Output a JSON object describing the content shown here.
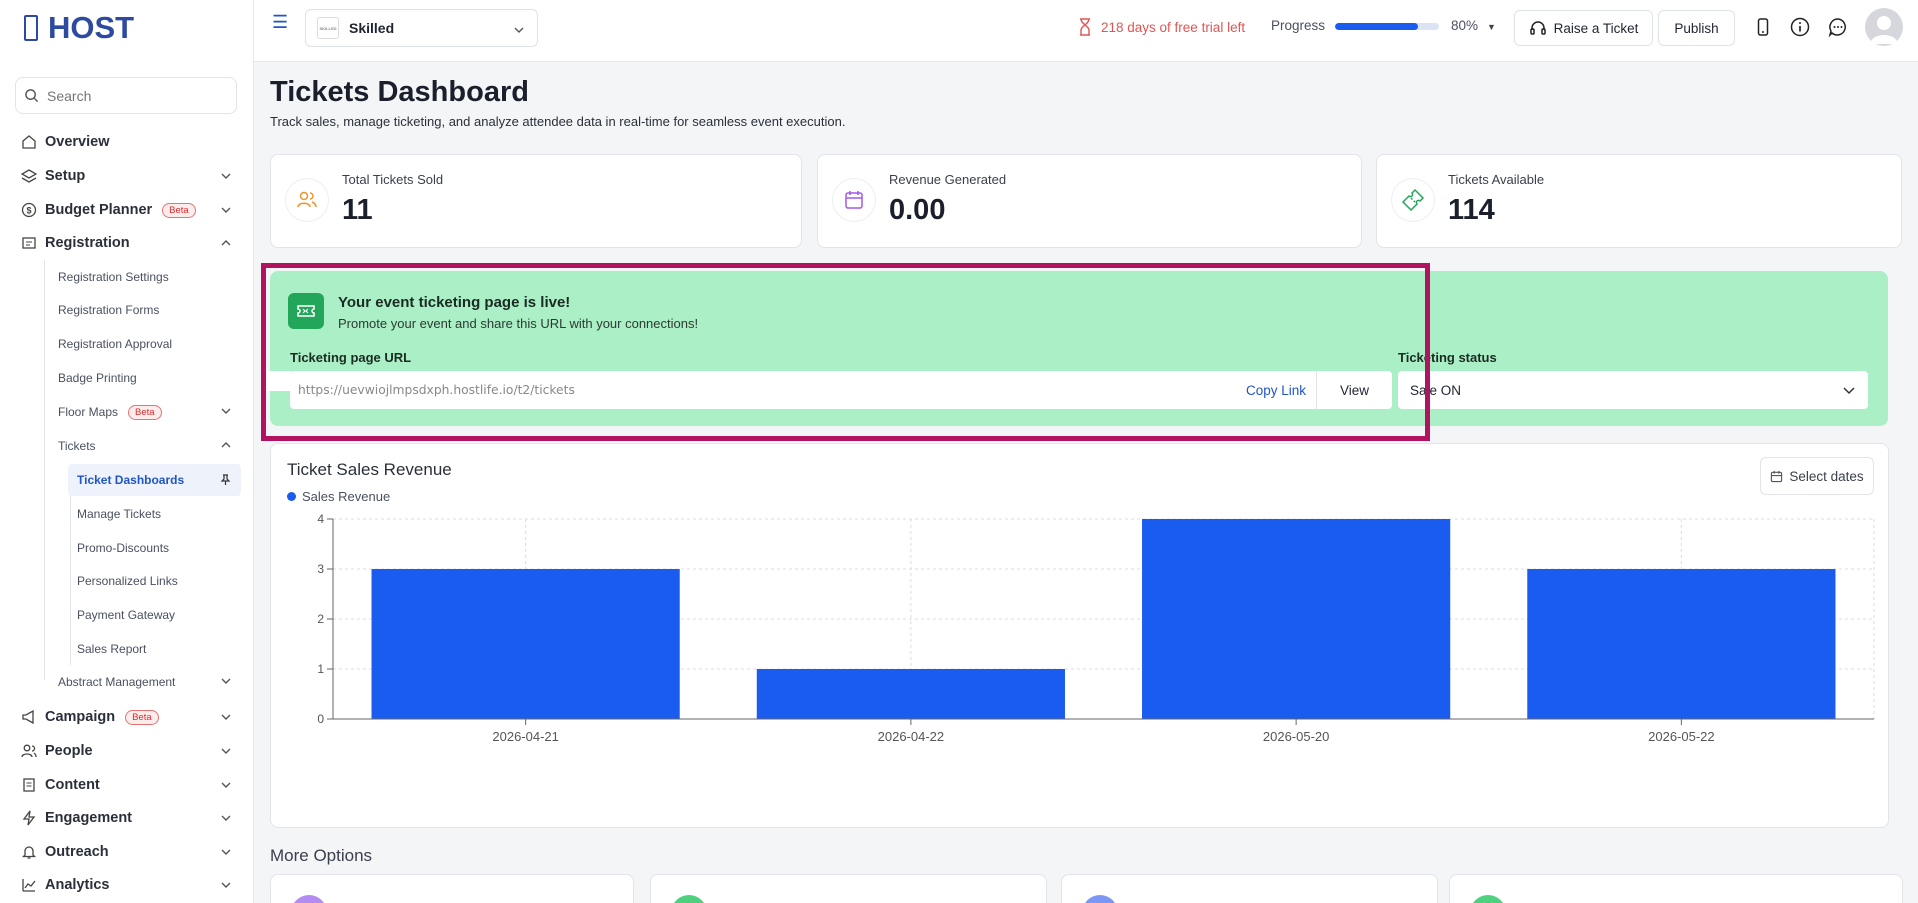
{
  "sidebar": {
    "logo": "HOST",
    "search_placeholder": "Search",
    "items": {
      "overview": "Overview",
      "setup": "Setup",
      "budget_planner": "Budget Planner",
      "registration": "Registration",
      "registration_settings": "Registration Settings",
      "registration_forms": "Registration Forms",
      "registration_approval": "Registration Approval",
      "badge_printing": "Badge Printing",
      "floor_maps": "Floor Maps",
      "tickets": "Tickets",
      "ticket_dashboards": "Ticket Dashboards",
      "manage_tickets": "Manage Tickets",
      "promo_discounts": "Promo-Discounts",
      "personalized_links": "Personalized Links",
      "payment_gateway": "Payment Gateway",
      "sales_report": "Sales Report",
      "abstract_management": "Abstract Management",
      "campaign": "Campaign",
      "people": "People",
      "content": "Content",
      "engagement": "Engagement",
      "outreach": "Outreach",
      "analytics": "Analytics"
    },
    "beta_label": "Beta"
  },
  "topbar": {
    "event_name": "Skilled",
    "event_thumb_text": "SKILLED",
    "trial_text": "218 days of free trial left",
    "progress_label": "Progress",
    "progress_percent": 80,
    "progress_value": "80%",
    "raise_ticket": "Raise a Ticket",
    "publish": "Publish"
  },
  "page": {
    "title": "Tickets Dashboard",
    "subtitle": "Track sales, manage ticketing, and analyze attendee data in real-time for seamless event execution."
  },
  "stats": [
    {
      "label": "Total Tickets Sold",
      "value": "11",
      "icon": "users-icon",
      "color": "#f0932b"
    },
    {
      "label": "Revenue Generated",
      "value": "0.00",
      "icon": "calendar-icon",
      "color": "#a259e6"
    },
    {
      "label": "Tickets Available",
      "value": "114",
      "icon": "ticket-icon",
      "color": "#22a65a"
    }
  ],
  "live": {
    "title": "Your event ticketing page is live!",
    "subtitle": "Promote your event and share this URL with your connections!",
    "url_label": "Ticketing page URL",
    "url": "https://uevwiojlmpsdxph.hostlife.io/t2/tickets",
    "copy_link": "Copy Link",
    "view": "View",
    "status_label": "Ticketing status",
    "status_value": "Sale ON"
  },
  "chart": {
    "title": "Ticket Sales Revenue",
    "select_dates": "Select dates",
    "color": "#1a5bf0"
  },
  "chart_data": {
    "type": "bar",
    "categories": [
      "2026-04-21",
      "2026-04-22",
      "2026-05-20",
      "2026-05-22"
    ],
    "series": [
      {
        "name": "Sales Revenue",
        "values": [
          3,
          1,
          4,
          3
        ]
      }
    ],
    "ylim": [
      0,
      4
    ],
    "yticks": [
      "0",
      "1",
      "2",
      "3",
      "4"
    ],
    "grid": true,
    "legend": "top-left"
  },
  "more_options": {
    "title": "More Options",
    "colors": [
      "#b48bf0",
      "#4fd07f",
      "#7c96f5",
      "#4fd07f"
    ]
  }
}
